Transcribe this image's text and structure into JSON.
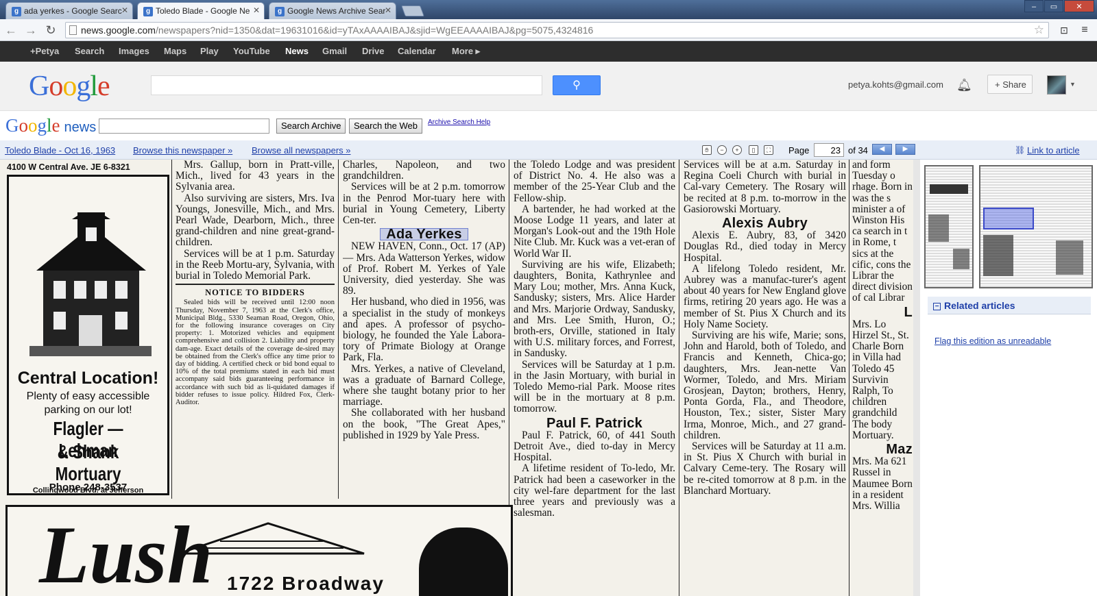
{
  "browser": {
    "tabs": [
      {
        "title": "ada yerkes - Google Searc",
        "active": false
      },
      {
        "title": "Toledo Blade - Google Ne",
        "active": true
      },
      {
        "title": "Google News Archive Sear",
        "active": false
      }
    ],
    "url_host": "news.google.com",
    "url_path": "/newspapers?nid=1350&dat=19631016&id=yTAxAAAAIBAJ&sjid=WgEEAAAAIBAJ&pg=5075,4324816"
  },
  "gbar": {
    "items": [
      "+Petya",
      "Search",
      "Images",
      "Maps",
      "Play",
      "YouTube",
      "News",
      "Gmail",
      "Drive",
      "Calendar",
      "More ▸"
    ],
    "active": "News"
  },
  "header": {
    "logo": "Google",
    "email": "petya.kohts@gmail.com",
    "share_label": "Share"
  },
  "newsbar": {
    "logo_google": "Google",
    "logo_news": "news",
    "search_archive": "Search Archive",
    "search_web": "Search the Web",
    "help": "Archive Search Help"
  },
  "viewer": {
    "paper_title": "Toledo Blade - Oct 16, 1963",
    "browse_this": "Browse this newspaper »",
    "browse_all": "Browse all newspapers »",
    "page_label": "Page",
    "page_value": "23",
    "page_of": "of 34",
    "link_label": "Link to article"
  },
  "sidebar": {
    "related": "Related articles",
    "flag": "Flag this edition as unreadable"
  },
  "colors": {
    "blue_link": "#1e3fa8",
    "search_blue": "#4d90fe",
    "gbar": "#2d2d2d"
  },
  "article": {
    "ad_address": "4100 W Central Ave.   JE 6-8321",
    "ad_headline": "Central Location!",
    "ad_line1": "Plenty of easy accessible",
    "ad_line2": "parking on our lot!",
    "ad_name1": "Flagler — Lehman",
    "ad_name2": "& Shank",
    "ad_name3": "Mortuary",
    "ad_street": "Collingwood Blvd. at Jefferson",
    "ad_phone": "Phone 248-3537",
    "col2_a": "Mrs. Gallup, born in Pratt-ville, Mich., lived for 43 years in the Sylvania area.",
    "col2_b": "Also surviving are sisters, Mrs. Iva Youngs, Jonesville, Mich., and Mrs. Pearl Wade, Dearborn, Mich., three grand-children and nine great-grand-children.",
    "col2_c": "Services will be at 1 p.m. Saturday in the Reeb Mortu-ary, Sylvania, with burial in Toledo Memorial Park.",
    "notice_title": "NOTICE TO BIDDERS",
    "notice_body": "Sealed bids will be received until 12:00 noon Thursday, November 7, 1963 at the Clerk's office, Municipal Bldg., 5330 Seaman Road, Oregon, Ohio, for the following insurance coverages on City property: 1. Motorized vehicles and equipment comprehensive and collision 2. Liability and property dam-age. Exact details of the coverage de-sired may be obtained from the Clerk's office any time prior to day of bidding. A certified check or bid bond equal to 10% of the total premiums stated in each bid must accompany said bids guaranteeing performance in accordance with such bid as li-quidated damages if bidder refuses to issue policy. Hildred Fox, Clerk-Auditor.",
    "col3_a": "Charles, Napoleon, and two grandchildren.",
    "col3_b": "Services will be at 2 p.m. tomorrow in the Penrod Mor-tuary here with burial in Young Cemetery, Liberty Cen-ter.",
    "col3_head": "Ada Yerkes",
    "col3_c": "NEW HAVEN, Conn., Oct. 17 (AP) — Mrs. Ada Watterson Yerkes, widow of Prof. Robert M. Yerkes of Yale University, died yesterday. She was 89.",
    "col3_d": "Her husband, who died in 1956, was a specialist in the study of monkeys and apes. A professor of psycho-biology, he founded the Yale Labora-tory of Primate Biology at Orange Park, Fla.",
    "col3_e": "Mrs. Yerkes, a native of Cleveland, was a graduate of Barnard College, where she taught botany prior to her marriage.",
    "col3_f": "She collaborated with her husband on the book, \"The Great Apes,\" published in 1929 by Yale Press.",
    "col4_a": "the Toledo Lodge and was president of District No. 4. He also was a member of the 25-Year Club and the Fellow-ship.",
    "col4_b": "A bartender, he had worked at the Moose Lodge 11 years, and later at Morgan's Look-out and the 19th Hole Nite Club. Mr. Kuck was a vet-eran of World War II.",
    "col4_c": "Surviving are his wife, Elizabeth; daughters, Bonita, Kathrynlee and Mary Lou; mother, Mrs. Anna Kuck, Sandusky; sisters, Mrs. Alice Harder and Mrs. Marjorie Ordway, Sandusky, and Mrs. Lee Smith, Huron, O.; broth-ers, Orville, stationed in Italy with U.S. military forces, and Forrest, in Sandusky.",
    "col4_d": "Services will be Saturday at 1 p.m. in the Jasin Mortuary, with burial in Toledo Memo-rial Park. Moose rites will be in the mortuary at 8 p.m. tomorrow.",
    "col4_head": "Paul F. Patrick",
    "col4_e": "Paul F. Patrick, 60, of 441 South Detroit Ave., died to-day in Mercy Hospital.",
    "col4_f": "A lifetime resident of To-ledo, Mr. Patrick had been a caseworker in the city wel-fare department for the last three years and previously was a salesman.",
    "col5_a": "Services will be at a.m. Saturday in Regina Coeli Church with burial in Cal-vary Cemetery. The Rosary will be recited at 8 p.m. to-morrow in the Gasiorowski Mortuary.",
    "col5_head": "Alexis Aubry",
    "col5_b": "Alexis E. Aubry, 83, of 3420 Douglas Rd., died today in Mercy Hospital.",
    "col5_c": "A lifelong Toledo resident, Mr. Aubrey was a manufac-turer's agent about 40 years for New England glove firms, retiring 20 years ago. He was a member of St. Pius X Church and its Holy Name Society.",
    "col5_d": "Surviving are his wife, Marie; sons, John and Harold, both of Toledo, and Francis and Kenneth, Chica-go; daughters, Mrs. Jean-nette Van Wormer, Toledo, and Mrs. Miriam Grosjean, Dayton; brothers, Henry, Ponta Gorda, Fla., and Theodore, Houston, Tex.; sister, Sister Mary Irma, Monroe, Mich., and 27 grand-children.",
    "col5_e": "Services will be Saturday at 11 a.m. in St. Pius X Church with burial in Calvary Ceme-tery. The Rosary will be re-cited tomorrow at 8 p.m. in the Blanchard Mortuary.",
    "col6_a": "and form Tuesday o rhage. Born in was the s minister a of Winston His ca search in t in Rome, t sics at the cific, cons the Librar the direct division of cal Librar",
    "col6_head1": "L",
    "col6_b": "Mrs. Lo Hirzel St., St. Charle Born in Villa had Toledo 45 Survivin Ralph, To children grandchild The body Mortuary.",
    "col6_head2": "Maz",
    "col6_c": "Mrs. Ma 621 Russel in Maumee Born in a resident Mrs. Willia",
    "lush_script": "Lush",
    "lush_addr": "1722 Broadway"
  }
}
